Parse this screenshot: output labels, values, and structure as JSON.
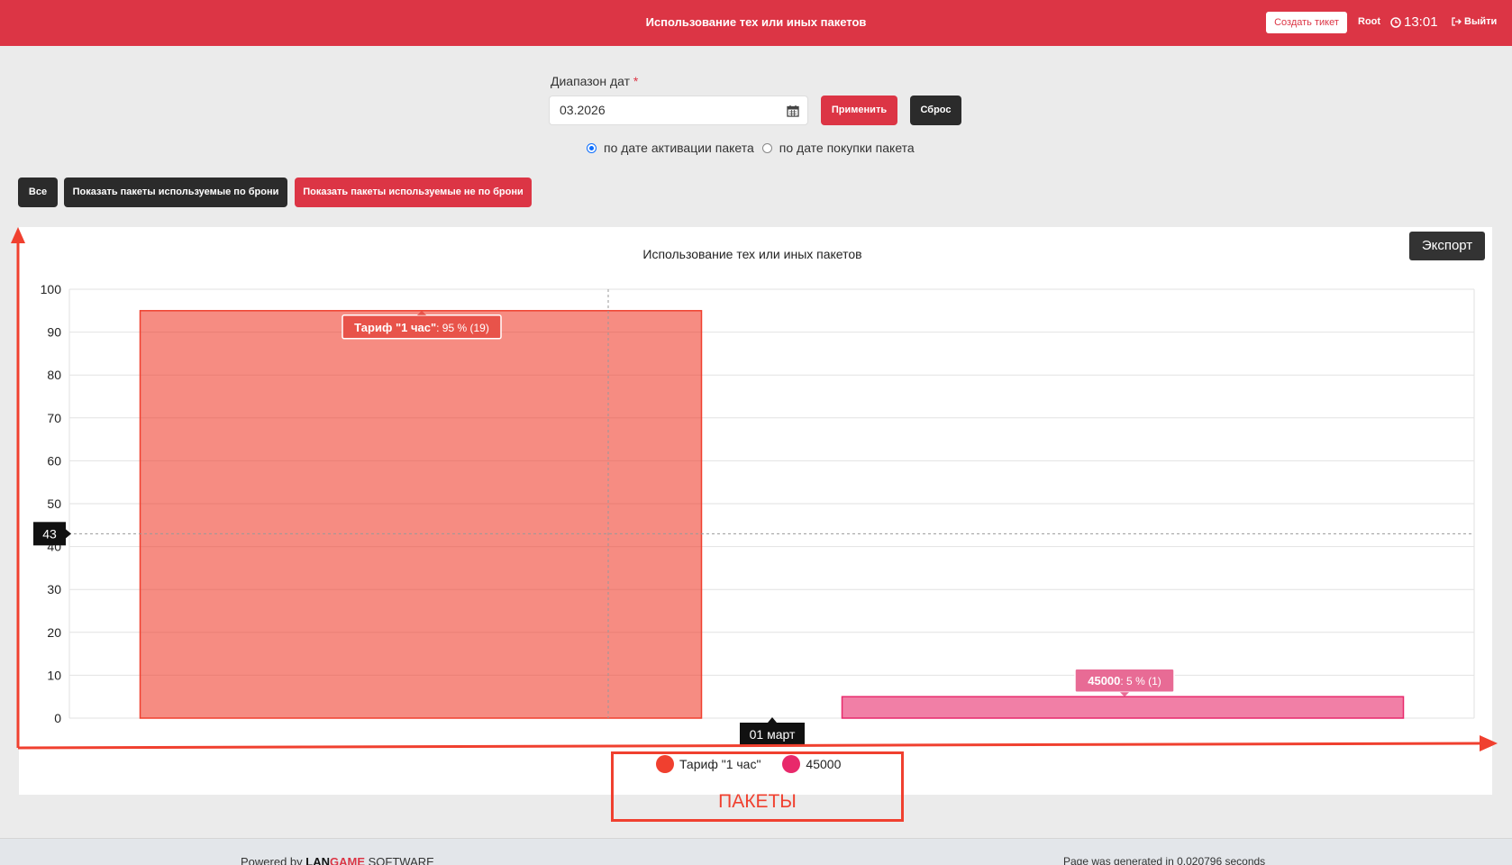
{
  "header": {
    "title": "Использование тех или иных пакетов",
    "create_ticket": "Создать тикет",
    "user": "Root",
    "time": "13:01",
    "logout": "Выйти"
  },
  "filters": {
    "date_range_label": "Диапазон дат",
    "required_mark": "*",
    "date_value": "03.2026",
    "apply": "Применить",
    "reset": "Сброс",
    "radio_activation": "по дате активации пакета",
    "radio_purchase": "по дате покупки пакета",
    "radio_selected": "activation",
    "btn_all": "Все",
    "btn_booked": "Показать пакеты используемые по брони",
    "btn_not_booked": "Показать пакеты используемые не по брони"
  },
  "export": "Экспорт",
  "chart_data": {
    "type": "bar",
    "title": "Использование тех или иных пакетов",
    "categories": [
      "01 март"
    ],
    "ylim": [
      0,
      100
    ],
    "yticks": [
      0,
      10,
      20,
      30,
      40,
      50,
      60,
      70,
      80,
      90,
      100
    ],
    "grid": true,
    "legend_position": "bottom",
    "series": [
      {
        "name": "Тариф \"1 час\"",
        "values": [
          95
        ],
        "count": 19,
        "color": "#f0402f",
        "tooltip_name": "Тариф \"1 час\"",
        "tooltip_value": ": 95 % (19)"
      },
      {
        "name": "45000",
        "values": [
          5
        ],
        "count": 1,
        "color": "#e8296b",
        "tooltip_name": "45000",
        "tooltip_value": ": 5 % (1)"
      }
    ],
    "crosshair_y": 43,
    "crosshair_y_label": "43",
    "crosshair_x_label": "01 март"
  },
  "annotation": {
    "label": "ПАКЕТЫ",
    "color": "#f0402f"
  },
  "footer": {
    "powered_prefix": "Powered by",
    "brand_a": "LAN",
    "brand_b": "GAME",
    "brand_c": " SOFTWARE",
    "generated": "Page was generated in 0.020796 seconds"
  }
}
